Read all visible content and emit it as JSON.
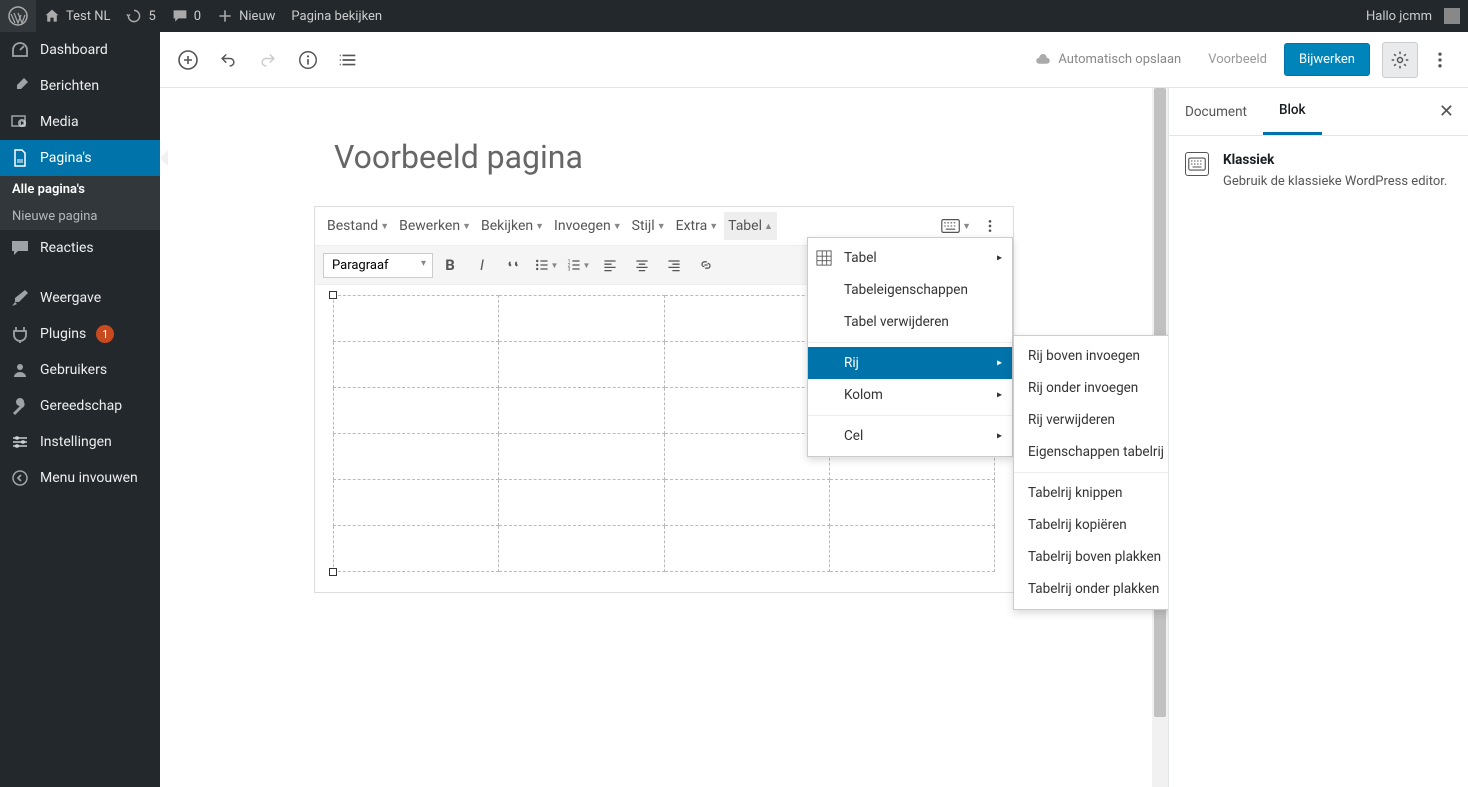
{
  "admin_bar": {
    "site_name": "Test NL",
    "updates": "5",
    "comments": "0",
    "new_label": "Nieuw",
    "view_page": "Pagina bekijken",
    "greeting": "Hallo jcmm"
  },
  "sidebar": {
    "items": [
      {
        "label": "Dashboard",
        "icon": "dashboard"
      },
      {
        "label": "Berichten",
        "icon": "pin"
      },
      {
        "label": "Media",
        "icon": "media"
      },
      {
        "label": "Pagina's",
        "icon": "page",
        "active": true
      },
      {
        "label": "Reacties",
        "icon": "comment"
      },
      {
        "label": "Weergave",
        "icon": "brush"
      },
      {
        "label": "Plugins",
        "icon": "plug",
        "badge": "1"
      },
      {
        "label": "Gebruikers",
        "icon": "user"
      },
      {
        "label": "Gereedschap",
        "icon": "tool"
      },
      {
        "label": "Instellingen",
        "icon": "settings"
      },
      {
        "label": "Menu invouwen",
        "icon": "collapse"
      }
    ],
    "subitems": [
      {
        "label": "Alle pagina's",
        "current": true
      },
      {
        "label": "Nieuwe pagina",
        "current": false
      }
    ]
  },
  "editor_bar": {
    "autosave": "Automatisch opslaan",
    "preview": "Voorbeeld",
    "update": "Bijwerken"
  },
  "page": {
    "title": "Voorbeeld pagina"
  },
  "classic_menu": {
    "items": [
      "Bestand",
      "Bewerken",
      "Bekijken",
      "Invoegen",
      "Stijl",
      "Extra",
      "Tabel"
    ],
    "paragraph_select": "Paragraaf"
  },
  "table_menu": {
    "items": [
      {
        "label": "Tabel",
        "submenu": true,
        "icon": true
      },
      {
        "label": "Tabeleigenschappen"
      },
      {
        "label": "Tabel verwijderen"
      },
      {
        "label": "Rij",
        "submenu": true,
        "highlight": true
      },
      {
        "label": "Kolom",
        "submenu": true
      },
      {
        "label": "Cel",
        "submenu": true
      }
    ]
  },
  "row_submenu": {
    "group1": [
      "Rij boven invoegen",
      "Rij onder invoegen",
      "Rij verwijderen",
      "Eigenschappen tabelrij"
    ],
    "group2": [
      "Tabelrij knippen",
      "Tabelrij kopiëren",
      "Tabelrij boven plakken",
      "Tabelrij onder plakken"
    ]
  },
  "right_panel": {
    "tab_document": "Document",
    "tab_block": "Blok",
    "block_title": "Klassiek",
    "block_desc": "Gebruik de klassieke WordPress editor."
  }
}
